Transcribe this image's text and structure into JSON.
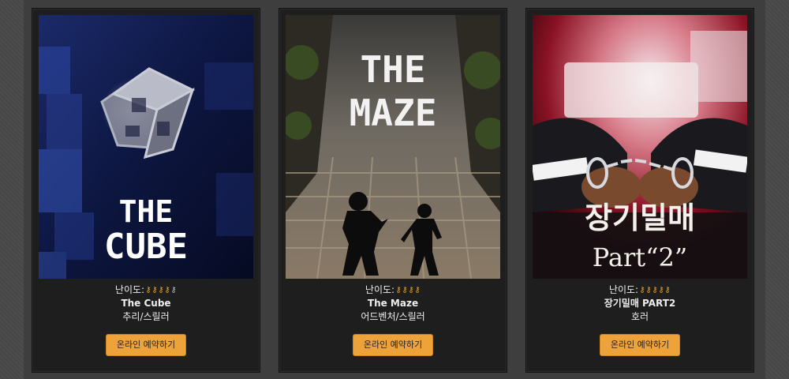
{
  "colors": {
    "accent": "#eda23a",
    "key_filled": "#e2a22b",
    "card_bg": "#1e1e1e"
  },
  "themes": [
    {
      "poster_title_lines": [
        "THE",
        "CUBE"
      ],
      "difficulty_label": "난이도:",
      "difficulty_level": 4,
      "difficulty_max": 5,
      "name": "The Cube",
      "genre": "추리/스릴러",
      "button_label": "온라인 예약하기"
    },
    {
      "poster_title_lines": [
        "THE",
        "MAZE"
      ],
      "difficulty_label": "난이도:",
      "difficulty_level": 4,
      "difficulty_max": 4,
      "name": "The Maze",
      "genre": "어드벤처/스릴러",
      "button_label": "온라인 예약하기"
    },
    {
      "poster_title_lines": [
        "장기밀매",
        "Part“2”"
      ],
      "difficulty_label": "난이도:",
      "difficulty_level": 5,
      "difficulty_max": 5,
      "name": "장기밀매 PART2",
      "genre": "호러",
      "button_label": "온라인 예약하기"
    }
  ]
}
